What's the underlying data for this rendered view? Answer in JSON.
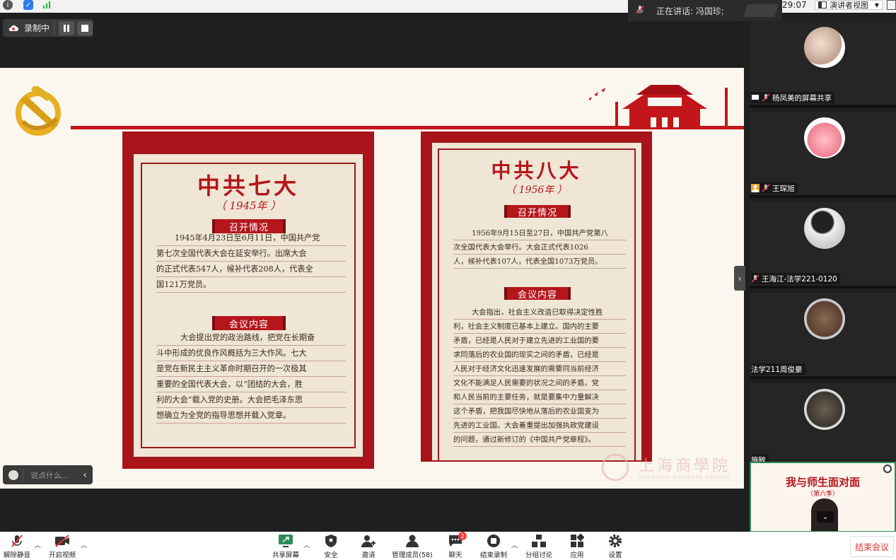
{
  "topbar": {
    "speaking_label": "正在讲话: 冯国珍;",
    "timer": "29:07",
    "view_button": "演讲者视图"
  },
  "recording": {
    "label": "录制中"
  },
  "slide": {
    "left_card": {
      "title": "中共七大",
      "year": "（ 1945年 ）",
      "section1": "召开情况",
      "section1_lines": [
        "1945年4月23日至6月11日，中国共产党",
        "第七次全国代表大会在延安举行。出席大会",
        "的正式代表547人，候补代表208人，代表全",
        "国121万党员。"
      ],
      "section2": "会议内容",
      "section2_lines": [
        "大会提出党的政治路线，把党在长期奋",
        "斗中形成的优良作风概括为三大作风。七大",
        "是党在新民主主义革命时期召开的一次极其",
        "重要的全国代表大会，以“团结的大会，胜",
        "利的大会”载入党的史册。大会把毛泽东思",
        "想确立为全党的指导思想并载入党章。"
      ]
    },
    "right_card": {
      "title": "中共八大",
      "year": "（ 1956年 ）",
      "section1": "召开情况",
      "section1_lines": [
        "1956年9月15日至27日，中国共产党第八",
        "次全国代表大会举行。大会正式代表1026",
        "人，候补代表107人，代表全国1073万党员。"
      ],
      "section2": "会议内容",
      "section2_lines": [
        "大会指出，社会主义改造已取得决定性胜",
        "利，社会主义制度已基本上建立。国内的主要",
        "矛盾，已经是人民对于建立先进的工业国的要",
        "求同落后的农业国的现实之间的矛盾，已经是",
        "人民对于经济文化迅速发展的需要同当前经济",
        "文化不能满足人民需要的状况之间的矛盾。党",
        "和人民当前的主要任务，就是要集中力量解决",
        "这个矛盾，把我国尽快地从落后的农业国变为",
        "先进的工业国。大会着重提出加强执政党建设",
        "的问题，通过新修订的《中国共产党章程》。"
      ]
    },
    "watermark": "上海商學院",
    "watermark_sub": "SHANGHAI BUSINESS SCHOOL"
  },
  "chat": {
    "placeholder": "说点什么..."
  },
  "participants": [
    {
      "name": "杨凤美的屏幕共享"
    },
    {
      "name": "王琛旭"
    },
    {
      "name": "王海江-法学221-0120"
    },
    {
      "name": "法学211周俊豪"
    },
    {
      "name": "施敏"
    }
  ],
  "video": {
    "title": "我与师生面对面",
    "subtitle": "（第六季）"
  },
  "toolbar": {
    "mute": "解除静音",
    "video": "开启视频",
    "share": "共享屏幕",
    "security": "安全",
    "invite": "邀请",
    "members": "管理成员(58)",
    "chat": "聊天",
    "chat_badge": "2",
    "end_record": "结束录制",
    "breakout": "分组讨论",
    "apps": "应用",
    "settings": "设置",
    "end_meeting": "结束会议"
  },
  "colors": {
    "party_red": "#b5161c",
    "accent_green": "#2e8b57",
    "end_red": "#e0302a"
  }
}
